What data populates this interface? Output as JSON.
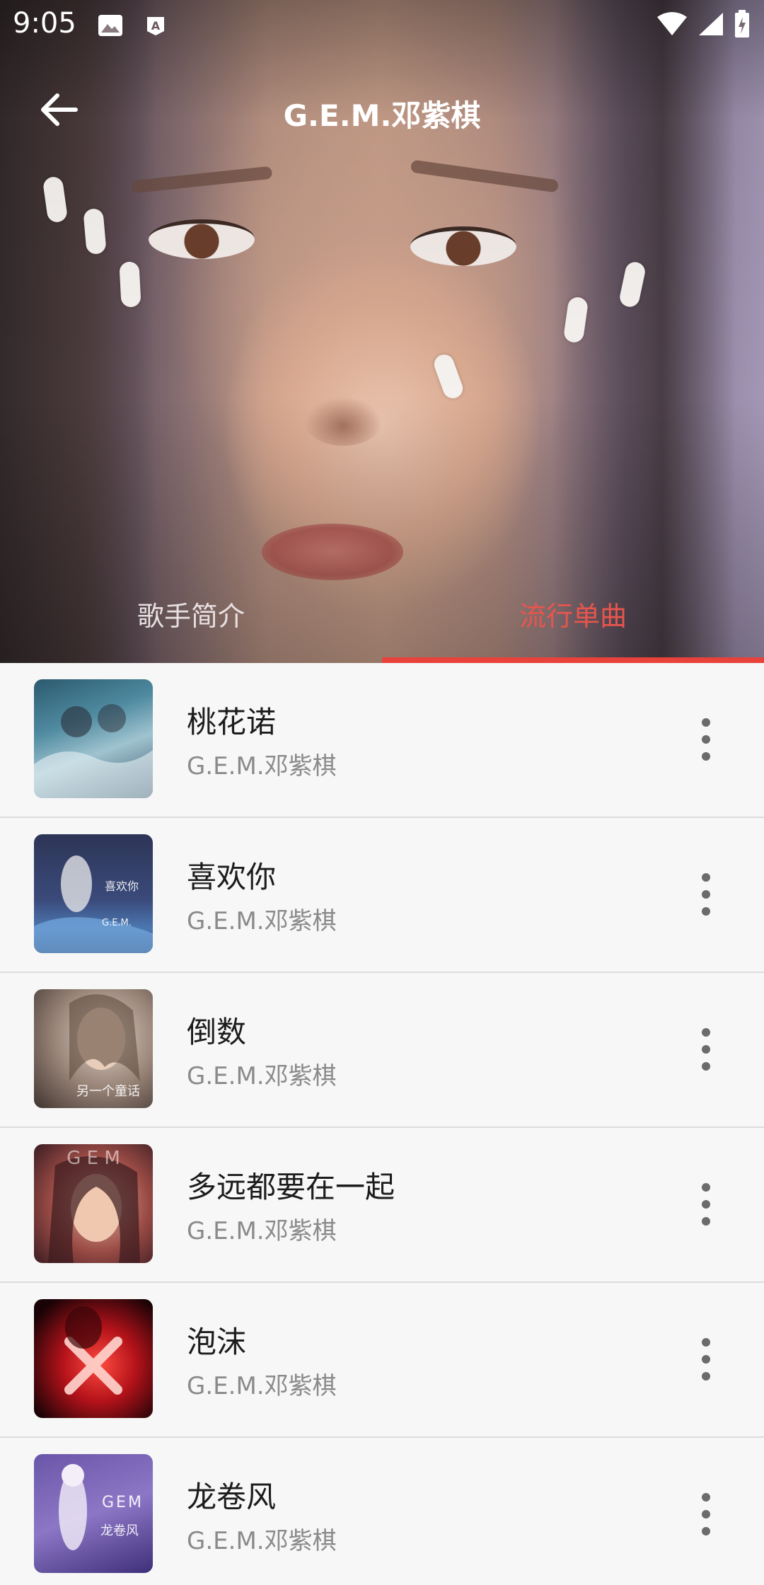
{
  "status_bar": {
    "time": "9:05"
  },
  "header": {
    "title": "G.E.M.邓紫棋"
  },
  "tabs": [
    {
      "label": "歌手简介",
      "active": false
    },
    {
      "label": "流行单曲",
      "active": true
    }
  ],
  "colors": {
    "accent": "#e8423a",
    "background": "#f7f7f7",
    "title_text": "#1c1c1c",
    "subtitle_text": "#8a8a8a"
  },
  "songs": [
    {
      "title": "桃花诺",
      "artist": "G.E.M.邓紫棋"
    },
    {
      "title": "喜欢你",
      "artist": "G.E.M.邓紫棋"
    },
    {
      "title": "倒数",
      "artist": "G.E.M.邓紫棋"
    },
    {
      "title": "多远都要在一起",
      "artist": "G.E.M.邓紫棋"
    },
    {
      "title": "泡沫",
      "artist": "G.E.M.邓紫棋"
    },
    {
      "title": "龙卷风",
      "artist": "G.E.M.邓紫棋"
    }
  ],
  "cover_art_text": [
    "喜欢你",
    "G.E.M.",
    "另一个童话",
    "GEM",
    "龙卷风"
  ],
  "icons": {
    "back": "arrow-left-icon",
    "more": "more-vert-icon",
    "wifi": "wifi-icon",
    "signal": "signal-icon",
    "battery": "battery-icon",
    "gallery": "gallery-icon",
    "store": "store-icon"
  }
}
